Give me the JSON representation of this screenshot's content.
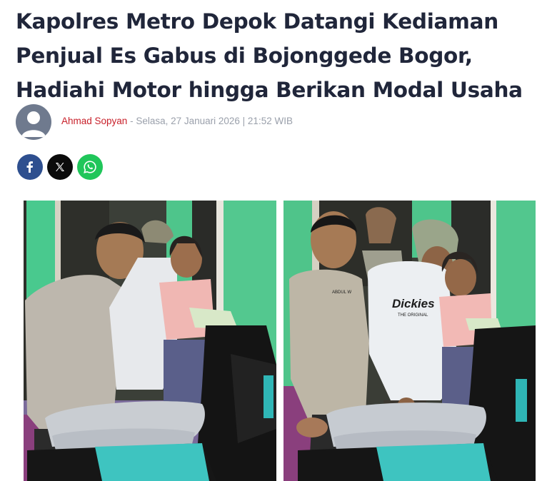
{
  "article": {
    "headline_lines": [
      "Kapolres Metro Depok Datangi Kediaman",
      "Penjual Es Gabus di Bojonggede Bogor,",
      "Hadiahi Motor hingga Berikan Modal Usaha"
    ],
    "author": "Ahmad Sopyan",
    "separator": " - ",
    "date": "Selasa, 27 Januari 2026 | 21:52 WIB"
  },
  "share": [
    {
      "name": "facebook",
      "icon": "facebook-icon",
      "color": "#2e4f8f"
    },
    {
      "name": "x",
      "icon": "x-icon",
      "color": "#0b0b0b"
    },
    {
      "name": "whatsapp",
      "icon": "whatsapp-icon",
      "color": "#20c65a"
    }
  ],
  "photos": {
    "shirt_print": "Dickies",
    "shirt_subprint": "THE ORIGINAL",
    "name_tag": "ABDUL W"
  },
  "colors": {
    "headline": "#20263a",
    "author": "#c8202a",
    "meta": "#9aa0ab",
    "wall_green": "#4fc48a"
  }
}
